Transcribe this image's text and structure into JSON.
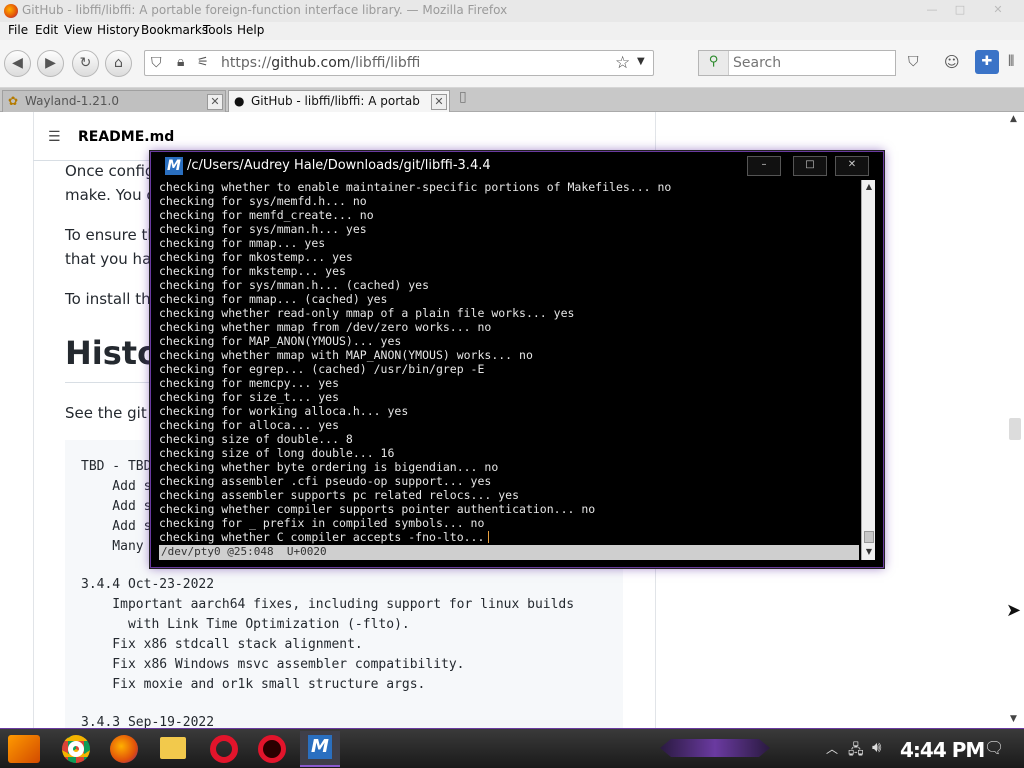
{
  "window": {
    "title": "GitHub - libffi/libffi: A portable foreign-function interface library. — Mozilla Firefox",
    "min": "—",
    "max": "□",
    "close": "✕"
  },
  "menu": [
    "File",
    "Edit",
    "View",
    "History",
    "Bookmarks",
    "Tools",
    "Help"
  ],
  "nav": {
    "url_scheme": "https://",
    "url_host": "github.com",
    "url_path": "/libffi/libffi",
    "search_placeholder": "Search"
  },
  "tabs": [
    {
      "label": "Wayland-1.21.0",
      "active": false
    },
    {
      "label": "GitHub - libffi/libffi: A portab",
      "active": true
    }
  ],
  "readme": {
    "header": "README.md",
    "para1_line1": "Once config",
    "para1_line2": "make. You c",
    "para2_line1": "To ensure th",
    "para2_line2": "that you hav",
    "para3": "To install the",
    "history_heading": "Histo",
    "see_git": "See the git lo",
    "code_lines": [
      "TBD - TBD",
      "    Add s",
      "    Add s",
      "    Add s",
      "    Many",
      "",
      "3.4.4 Oct-23-2022",
      "    Important aarch64 fixes, including support for linux builds",
      "      with Link Time Optimization (-flto).",
      "    Fix x86 stdcall stack alignment.",
      "    Fix x86 Windows msvc assembler compatibility.",
      "    Fix moxie and or1k small structure args.",
      "",
      "3.4.3 Sep-19-2022"
    ]
  },
  "terminal": {
    "title": "/c/Users/Audrey Hale/Downloads/git/libffi-3.4.4",
    "icon_letter": "M",
    "lines": [
      "checking whether to enable maintainer-specific portions of Makefiles... no",
      "checking for sys/memfd.h... no",
      "checking for memfd_create... no",
      "checking for sys/mman.h... yes",
      "checking for mmap... yes",
      "checking for mkostemp... yes",
      "checking for mkstemp... yes",
      "checking for sys/mman.h... (cached) yes",
      "checking for mmap... (cached) yes",
      "checking whether read-only mmap of a plain file works... yes",
      "checking whether mmap from /dev/zero works... no",
      "checking for MAP_ANON(YMOUS)... yes",
      "checking whether mmap with MAP_ANON(YMOUS) works... no",
      "checking for egrep... (cached) /usr/bin/grep -E",
      "checking for memcpy... yes",
      "checking for size_t... yes",
      "checking for working alloca.h... yes",
      "checking for alloca... yes",
      "checking size of double... 8",
      "checking size of long double... 16",
      "checking whether byte ordering is bigendian... no",
      "checking assembler .cfi pseudo-op support... yes",
      "checking assembler supports pc related relocs... yes",
      "checking whether compiler supports pointer authentication... no",
      "checking for _ prefix in compiled symbols... no",
      "checking whether C compiler accepts -fno-lto..."
    ],
    "status": "/dev/pty0 @25:048  U+0020"
  },
  "taskbar": {
    "clock": "4:44 PM"
  },
  "colors": {
    "accent_purple": "#6a3aa0",
    "terminal_bg": "#000000"
  }
}
